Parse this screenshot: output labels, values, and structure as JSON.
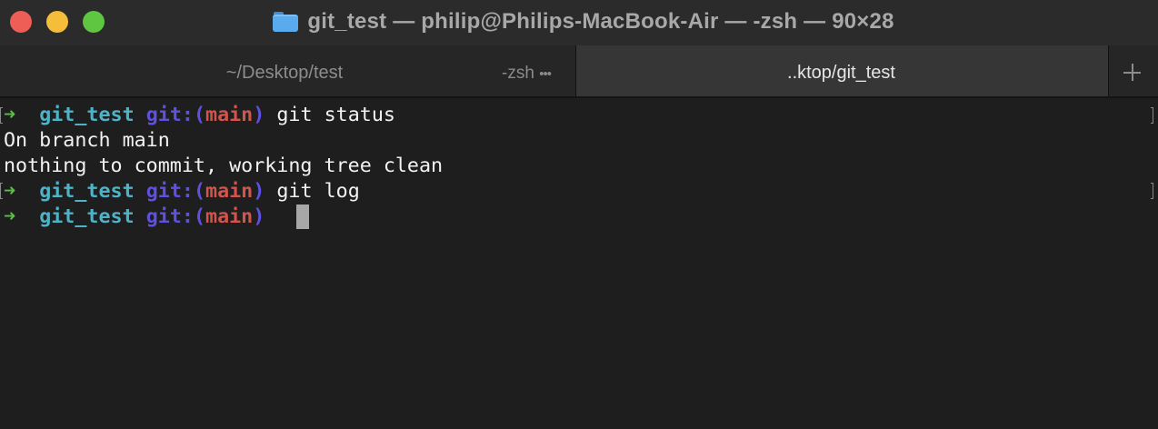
{
  "window": {
    "title": "git_test — philip@Philips-MacBook-Air — -zsh — 90×28",
    "title_icon": "folder-icon"
  },
  "tabs": [
    {
      "label": "~/Desktop/test",
      "process": "-zsh",
      "more": "•••",
      "active": false
    },
    {
      "label": "..ktop/git_test",
      "active": true
    }
  ],
  "new_tab": {
    "icon": "plus-icon"
  },
  "terminal": {
    "prompt": {
      "arrow": "➜",
      "dir": "git_test",
      "git_label": "git:(",
      "branch": "main",
      "git_close": ")"
    },
    "commands": [
      "git status",
      "git log"
    ],
    "output": [
      "On branch main",
      "nothing to commit, working tree clean"
    ]
  },
  "colors": {
    "arrow": "#57c23e",
    "dir": "#4fb3c7",
    "git": "#5e50e0",
    "branch": "#d2544a",
    "background": "#1e1e1e",
    "cursor": "#a7a7a7"
  }
}
